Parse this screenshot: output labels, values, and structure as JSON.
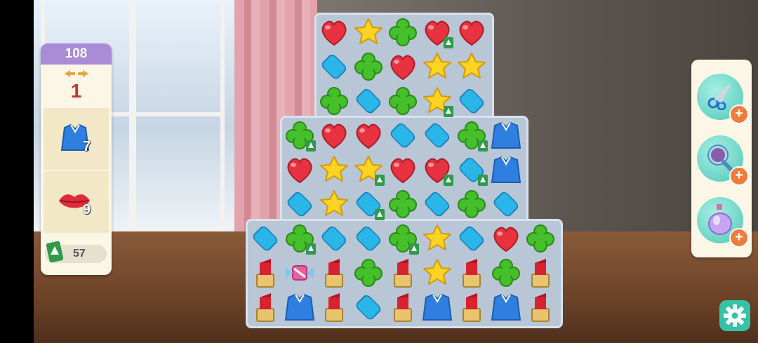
{
  "moves": {
    "label": "108",
    "count": "1"
  },
  "goals": [
    {
      "name": "shirt-goal",
      "count": "7"
    },
    {
      "name": "lips-goal",
      "count": "9"
    }
  ],
  "currency": {
    "value": "57"
  },
  "colors": {
    "panel_header": "#a98bd6",
    "moves": "#c0392b",
    "accent": "#35c2a8",
    "plus": "#f07c3b"
  },
  "board": {
    "rows": [
      [
        "",
        "",
        "heart",
        "star",
        "clover",
        "heart*",
        "heart",
        "",
        ""
      ],
      [
        "",
        "",
        "diamond",
        "clover",
        "heart",
        "star",
        "star",
        "",
        ""
      ],
      [
        "",
        "",
        "clover",
        "diamond",
        "clover",
        "star*",
        "diamond",
        "",
        ""
      ],
      [
        "",
        "clover*",
        "heart",
        "heart",
        "diamond",
        "diamond",
        "clover*",
        "shirt",
        ""
      ],
      [
        "",
        "heart",
        "star",
        "star*",
        "heart",
        "heart*",
        "diamond*",
        "shirt",
        ""
      ],
      [
        "",
        "diamond",
        "star",
        "diamond*",
        "clover",
        "diamond",
        "clover",
        "diamond",
        ""
      ],
      [
        "diamond",
        "clover*",
        "diamond",
        "diamond",
        "clover*",
        "star",
        "diamond",
        "heart",
        "clover"
      ],
      [
        "lipstick",
        "candy",
        "lipstick",
        "clover",
        "lipstick",
        "star",
        "lipstick",
        "clover",
        "lipstick"
      ],
      [
        "lipstick",
        "shirt",
        "lipstick",
        "diamond",
        "lipstick",
        "shirt",
        "lipstick",
        "shirt",
        "lipstick"
      ]
    ]
  },
  "tools": [
    "scissors-icon",
    "hairbrush-icon",
    "perfume-icon"
  ]
}
